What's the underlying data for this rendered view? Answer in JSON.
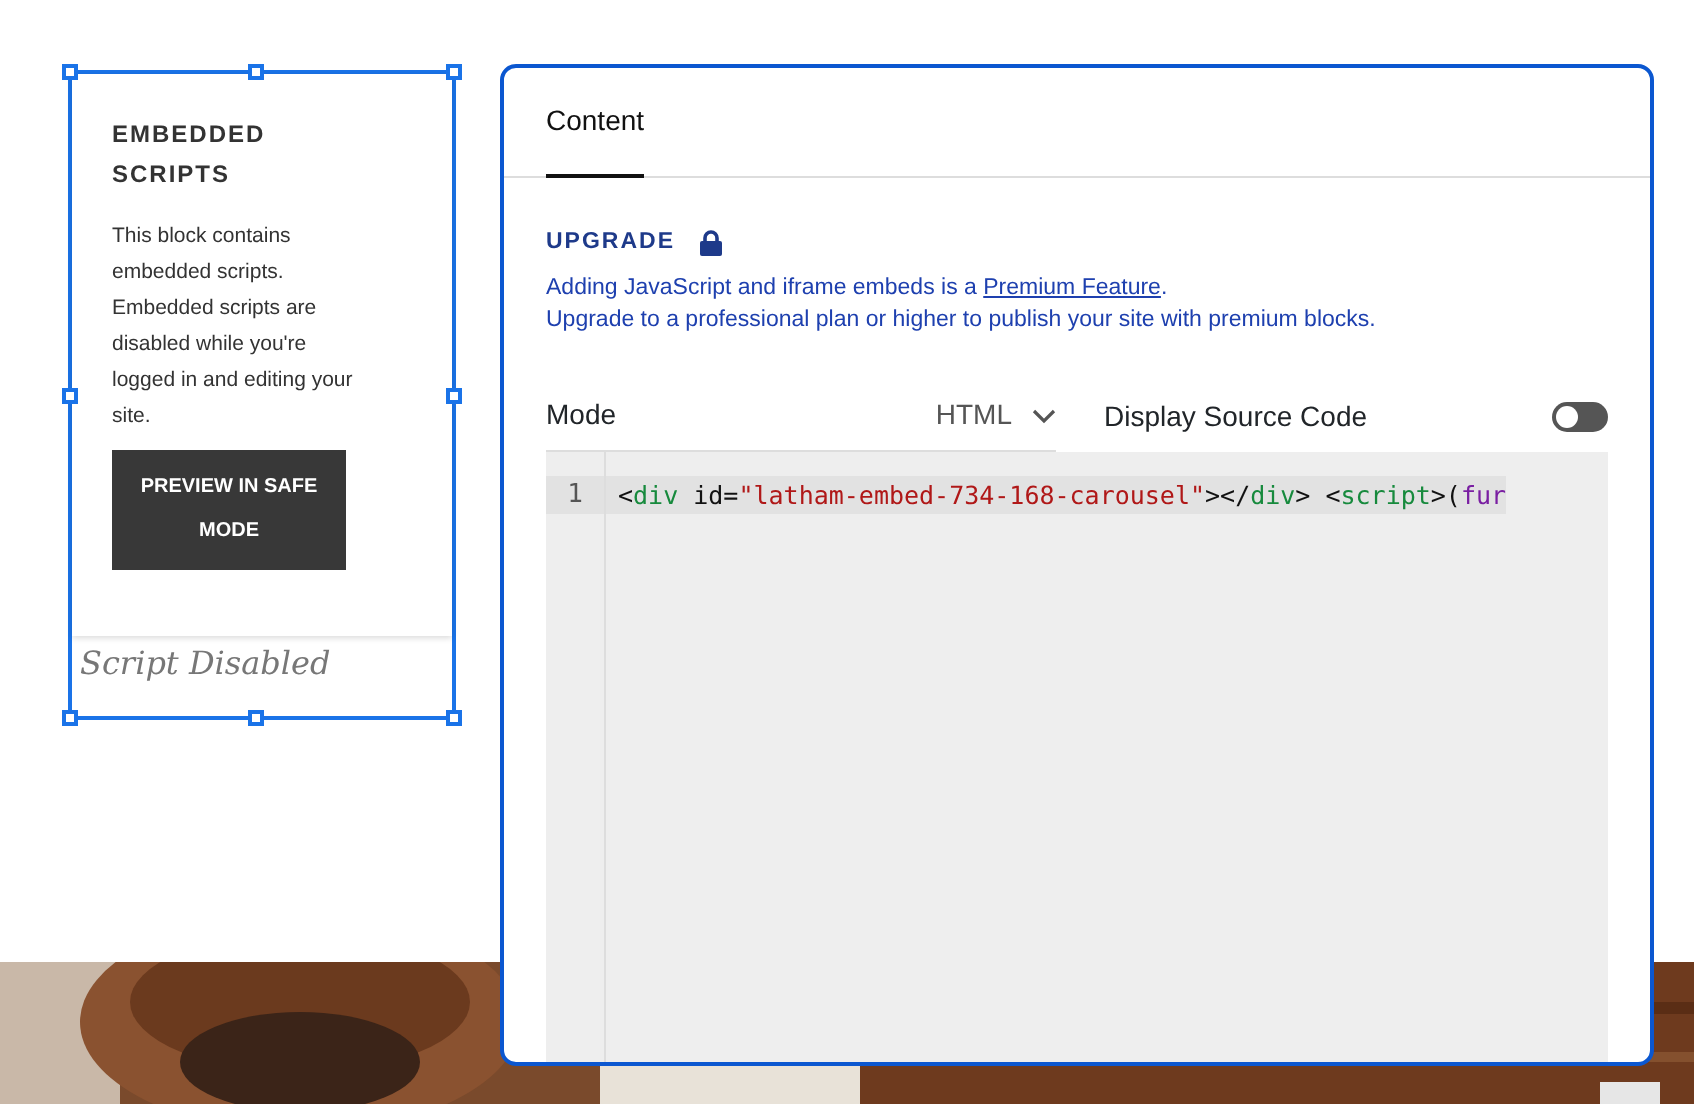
{
  "block": {
    "title": "EMBEDDED SCRIPTS",
    "description": "This block contains embedded scripts. Embedded scripts are disabled while you're logged in and editing your site.",
    "button": "PREVIEW IN SAFE MODE",
    "caption": "Script Disabled"
  },
  "panel": {
    "tabs": [
      {
        "label": "Content",
        "selected": true
      }
    ],
    "upgrade": {
      "label": "UPGRADE",
      "message": "Adding JavaScript and iframe embeds is a ",
      "link": "Premium Feature",
      "after_link": ".",
      "message_2": "Upgrade to a professional plan or higher to publish your site with premium blocks."
    },
    "mode": {
      "label": "Mode",
      "value": "HTML"
    },
    "display_source": {
      "label": "Display Source Code",
      "on": false
    },
    "code_lines": [
      {
        "number": "1",
        "tokens": [
          {
            "kind": "punct",
            "text": "<"
          },
          {
            "kind": "tag",
            "text": "div"
          },
          {
            "kind": "attr",
            "text": " id="
          },
          {
            "kind": "string",
            "text": "\"latham-embed-734-168-carousel\""
          },
          {
            "kind": "punct",
            "text": "></"
          },
          {
            "kind": "tag",
            "text": "div"
          },
          {
            "kind": "punct",
            "text": "> <"
          },
          {
            "kind": "tag",
            "text": "script"
          },
          {
            "kind": "punct",
            "text": ">("
          },
          {
            "kind": "keyword",
            "text": "fur"
          }
        ]
      }
    ]
  }
}
